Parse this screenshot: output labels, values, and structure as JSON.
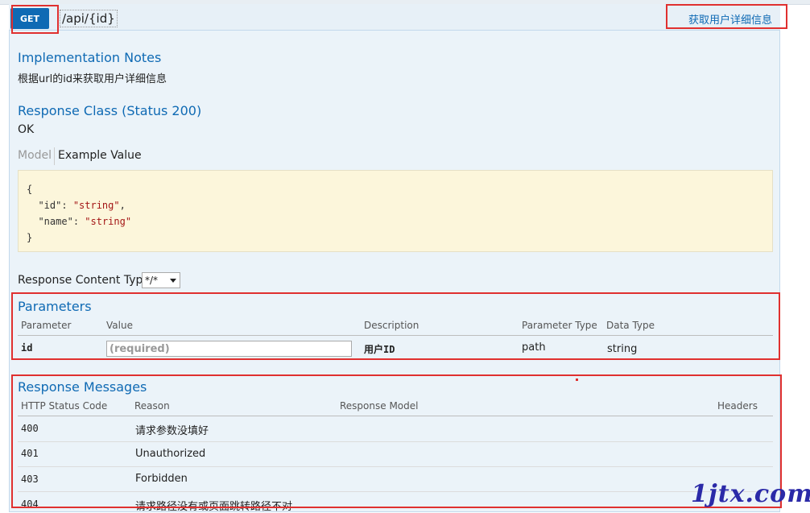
{
  "operation": {
    "method": "GET",
    "path": "/api/{id}",
    "summary": "获取用户详细信息"
  },
  "implementation_notes": {
    "heading": "Implementation Notes",
    "text": "根据url的id来获取用户详细信息"
  },
  "response_class": {
    "heading": "Response Class (Status 200)",
    "text": "OK",
    "tabs": [
      "Model",
      "Example Value"
    ],
    "example_lines": [
      "{",
      "  \"id\": \"string\",",
      "  \"name\": \"string\"",
      "}"
    ]
  },
  "response_content_type": {
    "label": "Response Content Type",
    "selected": "*/*"
  },
  "parameters": {
    "heading": "Parameters",
    "columns": [
      "Parameter",
      "Value",
      "Description",
      "Parameter Type",
      "Data Type"
    ],
    "rows": [
      {
        "name": "id",
        "placeholder": "(required)",
        "description": "用户ID",
        "param_type": "path",
        "data_type": "string"
      }
    ]
  },
  "response_messages": {
    "heading": "Response Messages",
    "columns": [
      "HTTP Status Code",
      "Reason",
      "Response Model",
      "Headers"
    ],
    "rows": [
      {
        "code": "400",
        "reason": "请求参数没填好"
      },
      {
        "code": "401",
        "reason": "Unauthorized"
      },
      {
        "code": "403",
        "reason": "Forbidden"
      },
      {
        "code": "404",
        "reason": "请求路径没有或页面跳转路径不对"
      }
    ]
  },
  "watermark": "1jtx.com",
  "colors": {
    "get_badge": "#0f6ab4",
    "heading": "#0f6ab4",
    "panel_bg": "#ebf3f9",
    "highlight_box": "#e0302f",
    "code_bg": "#fcf6db"
  }
}
